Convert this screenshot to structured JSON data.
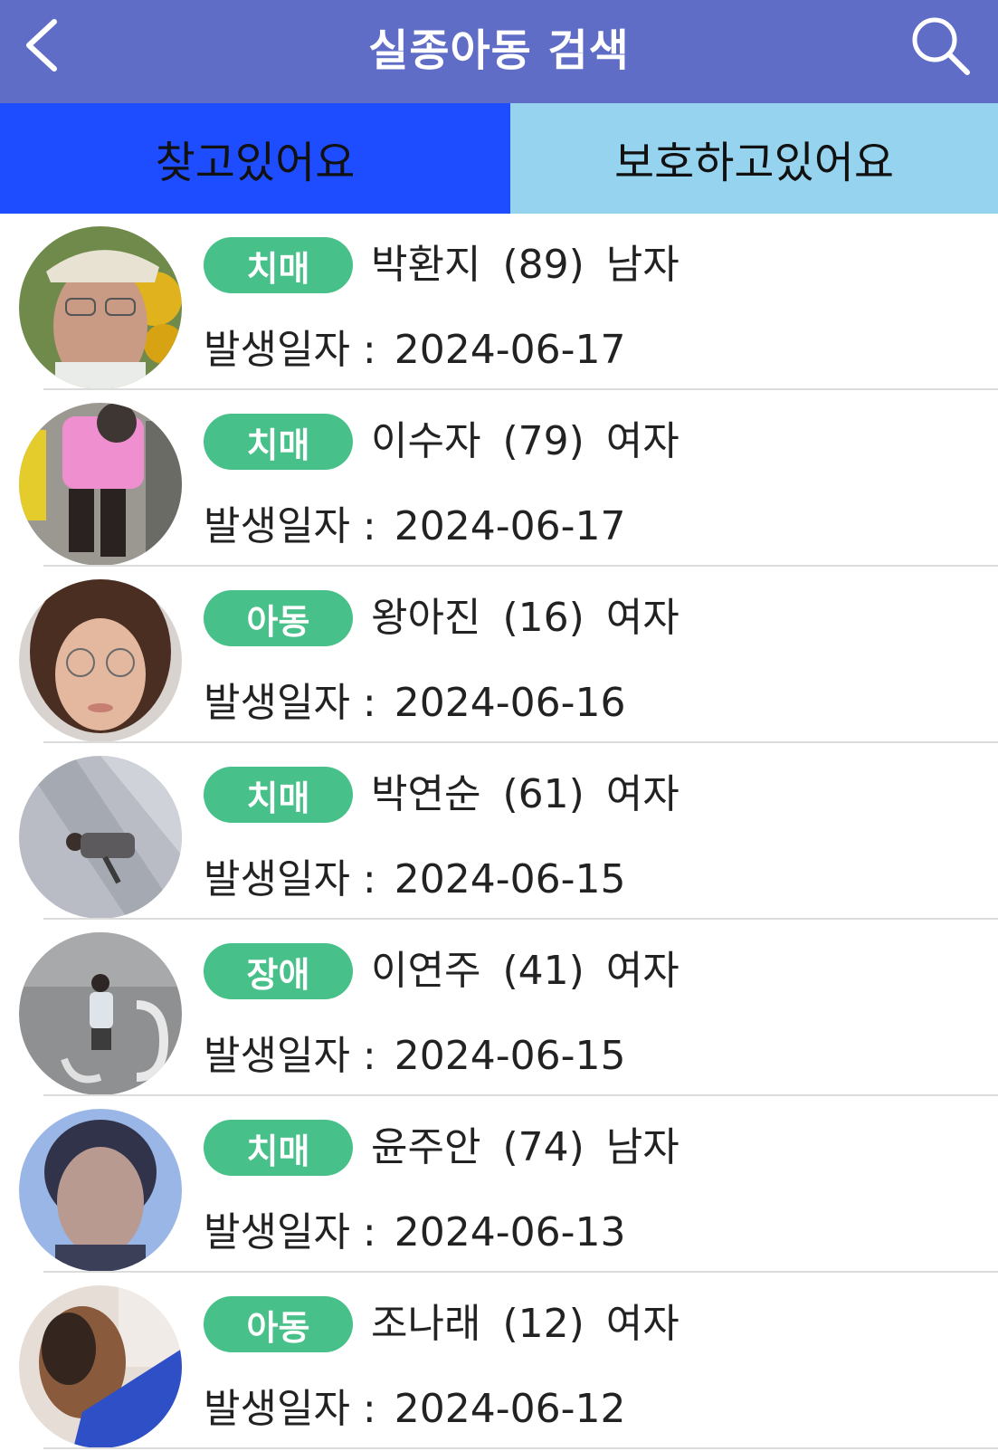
{
  "header": {
    "title": "실종아동 검색",
    "back_icon": "chevron-left-icon",
    "search_icon": "search-icon"
  },
  "tabs": [
    {
      "label": "찾고있어요",
      "active": true
    },
    {
      "label": "보호하고있어요",
      "active": false
    }
  ],
  "colors": {
    "header": "#5f6dc6",
    "tab_active": "#1e4cff",
    "tab_inactive": "#96d3ee",
    "badge": "#48c089"
  },
  "date_label": "발생일자 :",
  "items": [
    {
      "category": "치매",
      "name": "박환지",
      "age": "(89)",
      "gender": "남자",
      "date": "2024-06-17"
    },
    {
      "category": "치매",
      "name": "이수자",
      "age": "(79)",
      "gender": "여자",
      "date": "2024-06-17"
    },
    {
      "category": "아동",
      "name": "왕아진",
      "age": "(16)",
      "gender": "여자",
      "date": "2024-06-16"
    },
    {
      "category": "치매",
      "name": "박연순",
      "age": "(61)",
      "gender": "여자",
      "date": "2024-06-15"
    },
    {
      "category": "장애",
      "name": "이연주",
      "age": "(41)",
      "gender": "여자",
      "date": "2024-06-15"
    },
    {
      "category": "치매",
      "name": "윤주안",
      "age": "(74)",
      "gender": "남자",
      "date": "2024-06-13"
    },
    {
      "category": "아동",
      "name": "조나래",
      "age": "(12)",
      "gender": "여자",
      "date": "2024-06-12"
    }
  ]
}
